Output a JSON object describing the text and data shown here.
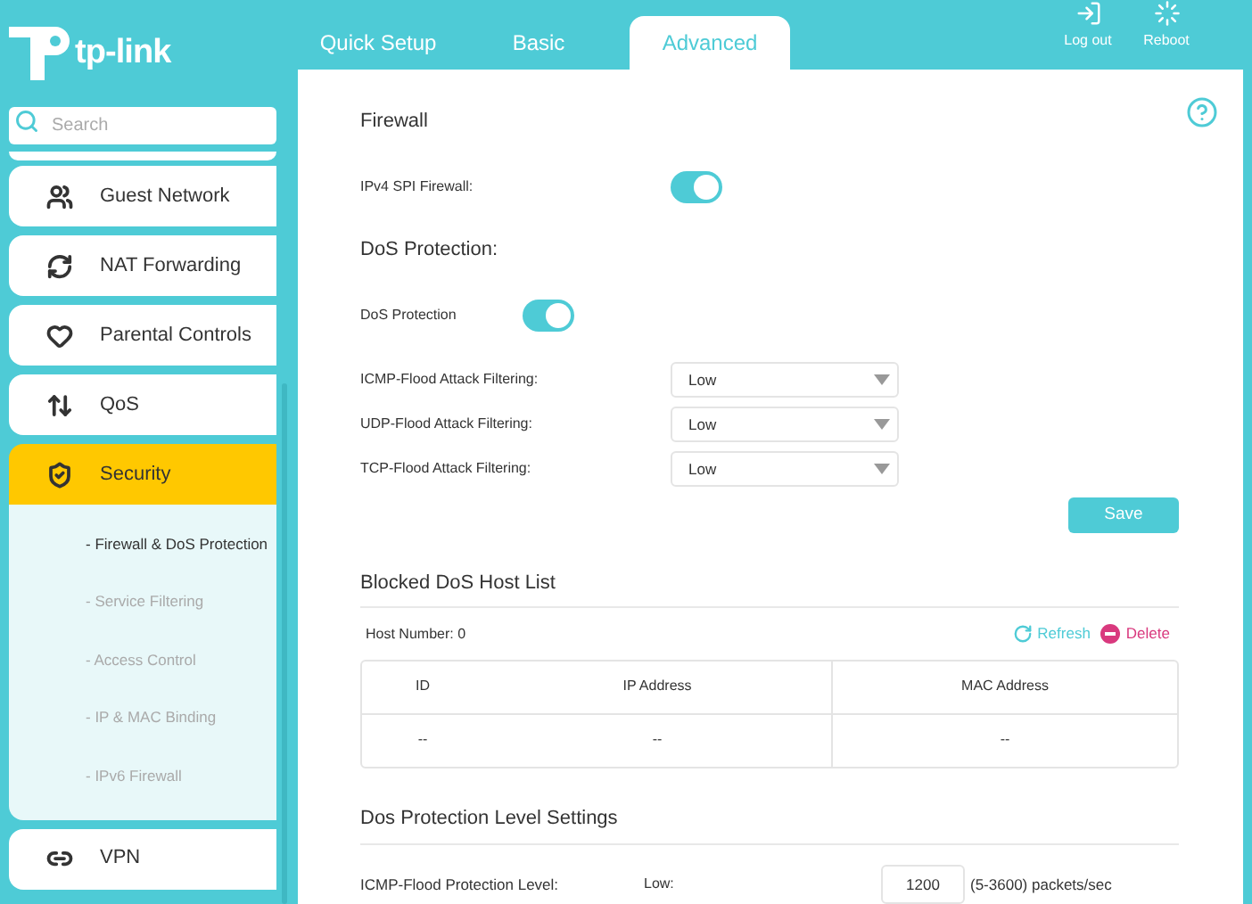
{
  "logo": {
    "text": "tp-link"
  },
  "tabs": [
    {
      "label": "Quick Setup",
      "selected": false
    },
    {
      "label": "Basic",
      "selected": false
    },
    {
      "label": "Advanced",
      "selected": true
    }
  ],
  "header_buttons": [
    {
      "kind": "logout",
      "label": "Log out"
    },
    {
      "kind": "reboot",
      "label": "Reboot"
    }
  ],
  "search": {
    "placeholder": "Search"
  },
  "sidebar": {
    "items": [
      {
        "kind": "guest",
        "label": "Guest Network",
        "selected": false
      },
      {
        "kind": "nat",
        "label": "NAT Forwarding",
        "selected": false
      },
      {
        "kind": "parental",
        "label": "Parental Controls",
        "selected": false
      },
      {
        "kind": "qos",
        "label": "QoS",
        "selected": false
      },
      {
        "kind": "security",
        "label": "Security",
        "selected": true,
        "children": [
          {
            "label": "- Firewall & DoS Protection",
            "selected": true
          },
          {
            "label": "- Service Filtering",
            "selected": false
          },
          {
            "label": "- Access Control",
            "selected": false
          },
          {
            "label": "- IP & MAC Binding",
            "selected": false
          },
          {
            "label": "- IPv6 Firewall",
            "selected": false
          }
        ]
      },
      {
        "kind": "vpn",
        "label": "VPN",
        "selected": false
      }
    ]
  },
  "firewall": {
    "title": "Firewall",
    "toggle": {
      "label": "IPv4 SPI Firewall:",
      "on": true
    }
  },
  "dos": {
    "title": "DoS Protection:",
    "toggle": {
      "label": "DoS Protection",
      "on": true
    },
    "selects": [
      {
        "label": "ICMP-Flood Attack Filtering:",
        "value": "Low"
      },
      {
        "label": "UDP-Flood Attack Filtering:",
        "value": "Low"
      },
      {
        "label": "TCP-Flood Attack Filtering:",
        "value": "Low"
      }
    ],
    "save": "Save"
  },
  "blocked": {
    "title": "Blocked DoS Host List",
    "host_number": "Host Number: 0",
    "refresh": "Refresh",
    "delete": "Delete",
    "table": {
      "columns": [
        "ID",
        "IP Address",
        "MAC Address"
      ],
      "rows": [
        [
          "--",
          "--",
          "--"
        ]
      ]
    }
  },
  "levels": {
    "title": "Dos Protection Level Settings",
    "rows": [
      {
        "label": "ICMP-Flood Protection Level:",
        "level_name": "Low:",
        "value": "1200",
        "unit": "(5-3600) packets/sec"
      }
    ]
  }
}
